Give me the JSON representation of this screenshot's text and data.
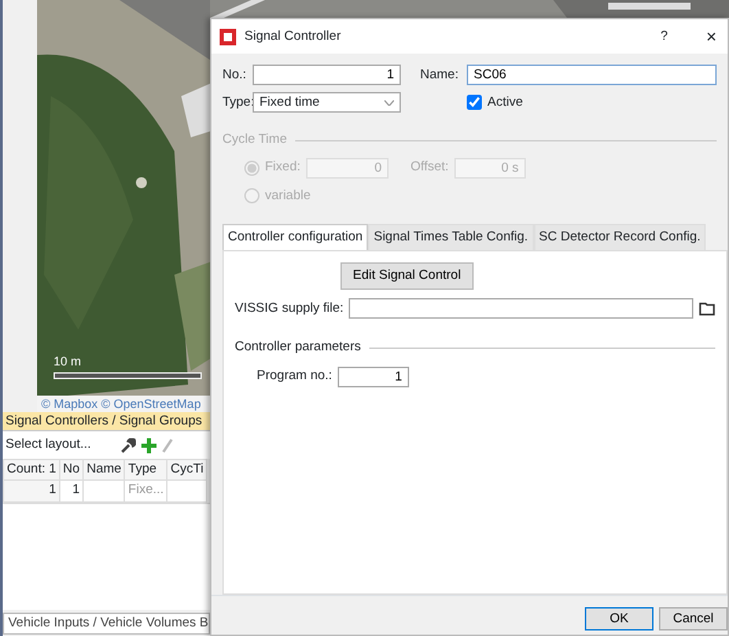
{
  "map": {
    "scale_label": "10 m",
    "attribution": "© Mapbox © OpenStreetMap"
  },
  "panel": {
    "title": "Signal Controllers / Signal Groups",
    "layout_select": "Select layout...",
    "columns": [
      "Count: 1",
      "No",
      "Name",
      "Type",
      "CycTi"
    ],
    "rows": [
      [
        "1",
        "1",
        "",
        "Fixe..."
      ]
    ]
  },
  "bottom_tab": "Vehicle Inputs / Vehicle Volumes B",
  "dialog": {
    "title": "Signal Controller",
    "help": "?",
    "close": "×",
    "no_label": "No.:",
    "no_value": "1",
    "name_label": "Name:",
    "name_value": "SC06",
    "type_label": "Type:",
    "type_value": "Fixed time",
    "active_label": "Active",
    "active_checked": true,
    "cycle_time": {
      "legend": "Cycle Time",
      "disabled": true,
      "options": [
        {
          "label": "Fixed:",
          "selected": true,
          "value": "0"
        },
        {
          "label": "variable",
          "selected": false
        }
      ],
      "offset_label": "Offset:",
      "offset_value": "0 s"
    },
    "tabs": [
      {
        "label": "Controller configuration",
        "selected": true
      },
      {
        "label": "Signal Times Table Config.",
        "selected": false
      },
      {
        "label": "SC Detector Record Config.",
        "selected": false
      }
    ],
    "edit_button": "Edit Signal Control",
    "supply_label": "VISSIG supply file:",
    "params_legend": "Controller parameters",
    "program_label": "Program no.:",
    "program_value": "1",
    "buttons": [
      "OK",
      "Cancel"
    ]
  }
}
